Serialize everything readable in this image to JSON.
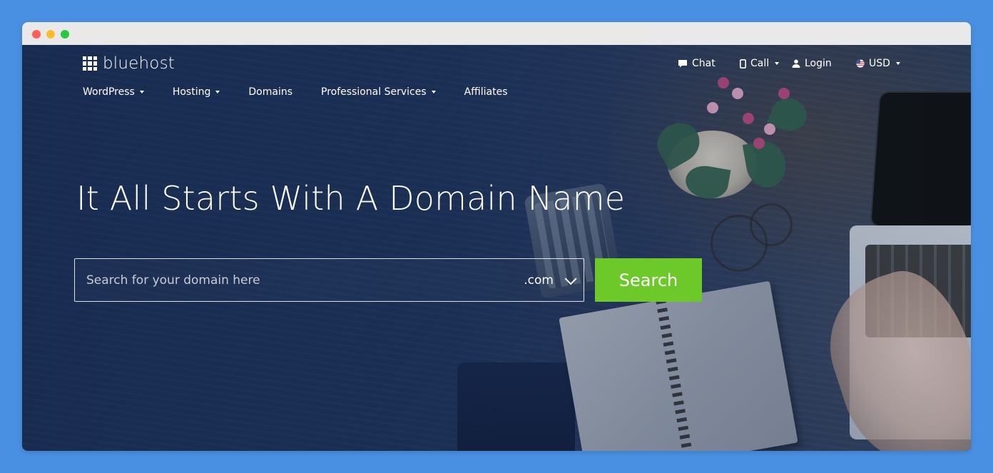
{
  "window": {
    "controls": [
      "close",
      "minimize",
      "maximize"
    ]
  },
  "header": {
    "logo_text": "bluehost",
    "top_links": {
      "chat": "Chat",
      "call": "Call",
      "login": "Login",
      "currency": "USD"
    },
    "nav": [
      {
        "label": "WordPress",
        "has_dropdown": true
      },
      {
        "label": "Hosting",
        "has_dropdown": true
      },
      {
        "label": "Domains",
        "has_dropdown": false
      },
      {
        "label": "Professional Services",
        "has_dropdown": true
      },
      {
        "label": "Affiliates",
        "has_dropdown": false
      }
    ]
  },
  "hero": {
    "title": "It All Starts With A Domain Name",
    "search": {
      "placeholder": "Search for your domain here",
      "value": "",
      "tld": ".com",
      "button_label": "Search"
    }
  },
  "colors": {
    "page_bg": "#4a90e2",
    "hero_bg": "#1d3157",
    "search_button": "#6dc829",
    "text": "#ffffff"
  },
  "icons": {
    "chat": "chat-bubble-icon",
    "call": "mobile-phone-icon",
    "login": "user-icon",
    "currency": "us-flag-icon",
    "tld_toggle": "chevron-down-icon",
    "logo": "grid-logo-icon"
  }
}
